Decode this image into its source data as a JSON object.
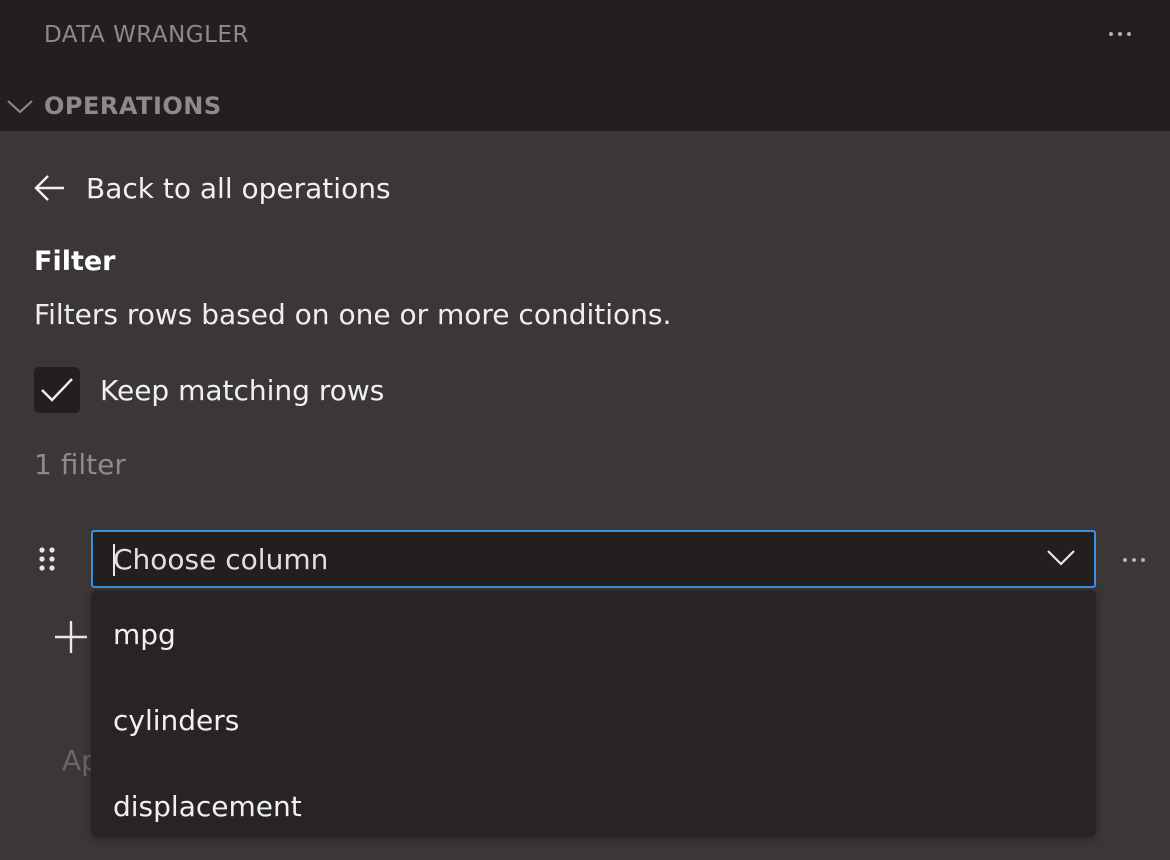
{
  "app": {
    "title": "DATA WRANGLER",
    "more_icon": "ellipsis-icon"
  },
  "section": {
    "title": "OPERATIONS",
    "expanded": true,
    "chevron_icon": "chevron-down-icon"
  },
  "back": {
    "label": "Back to all operations",
    "icon": "arrow-left-icon"
  },
  "operation": {
    "title": "Filter",
    "description": "Filters rows based on one or more conditions."
  },
  "keep_matching": {
    "label": "Keep matching rows",
    "checked": true,
    "icon": "check-icon"
  },
  "filter_count": "1 filter",
  "filter_row": {
    "column_placeholder": "Choose column",
    "drag_icon": "drag-handle-icon",
    "dropdown_icon": "chevron-down-icon",
    "more_icon": "ellipsis-icon"
  },
  "column_options": [
    "mpg",
    "cylinders",
    "displacement"
  ],
  "add_icon": "plus-icon",
  "apply_partial": "Ap",
  "colors": {
    "background": "#3b3737",
    "header_background": "#231f1f",
    "focus_border": "#3d8fe0",
    "muted_text": "#8e8a8a"
  }
}
